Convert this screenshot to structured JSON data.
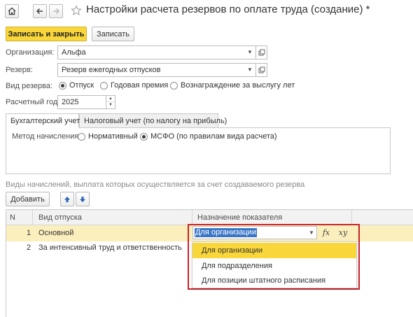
{
  "window": {
    "title": "Настройки расчета резервов по оплате труда (создание) *",
    "modified_mark": "*"
  },
  "toolbar": {
    "save_close_label": "Записать и закрыть",
    "save_label": "Записать"
  },
  "form": {
    "organization_label": "Организация:",
    "organization_value": "Альфа",
    "reserve_label": "Резерв:",
    "reserve_value": "Резерв ежегодных отпусков",
    "reserve_type_label": "Вид резерва:",
    "reserve_type_options": [
      "Отпуск",
      "Годовая премия",
      "Вознаграждение за выслугу лет"
    ],
    "reserve_type_selected": 0,
    "year_label": "Расчетный год:",
    "year_value": "2025"
  },
  "tabs": [
    {
      "label": "Бухгалтерский учет",
      "active": true
    },
    {
      "label": "Налоговый учет (по налогу на прибыль)",
      "active": false
    }
  ],
  "accounting": {
    "method_label": "Метод начисления:",
    "method_options": [
      "Нормативный",
      "МСФО (по правилам вида расчета)"
    ],
    "method_selected": 1
  },
  "accruals": {
    "section_title": "Виды начислений, выплата которых осуществляется за счет создаваемого резерва",
    "add_label": "Добавить",
    "columns": [
      "N",
      "Вид отпуска",
      "Назначение показателя"
    ],
    "rows": [
      {
        "n": "1",
        "type": "Основной",
        "purpose": "Для организации",
        "selected": true
      },
      {
        "n": "2",
        "type": "За интенсивный труд и ответственность",
        "purpose": "",
        "selected": false
      }
    ],
    "editor_value": "Для организации",
    "editor_fx": "fx",
    "editor_xy": "xy"
  },
  "dropdown": {
    "options": [
      "Для организации",
      "Для подразделения",
      "Для позиции штатного расписания"
    ],
    "highlighted": 0
  },
  "colors": {
    "accent_yellow": "#f9d73b",
    "row_selected": "#fcefbe",
    "highlight_border": "#c8222a",
    "link_blue": "#2a64b4"
  }
}
